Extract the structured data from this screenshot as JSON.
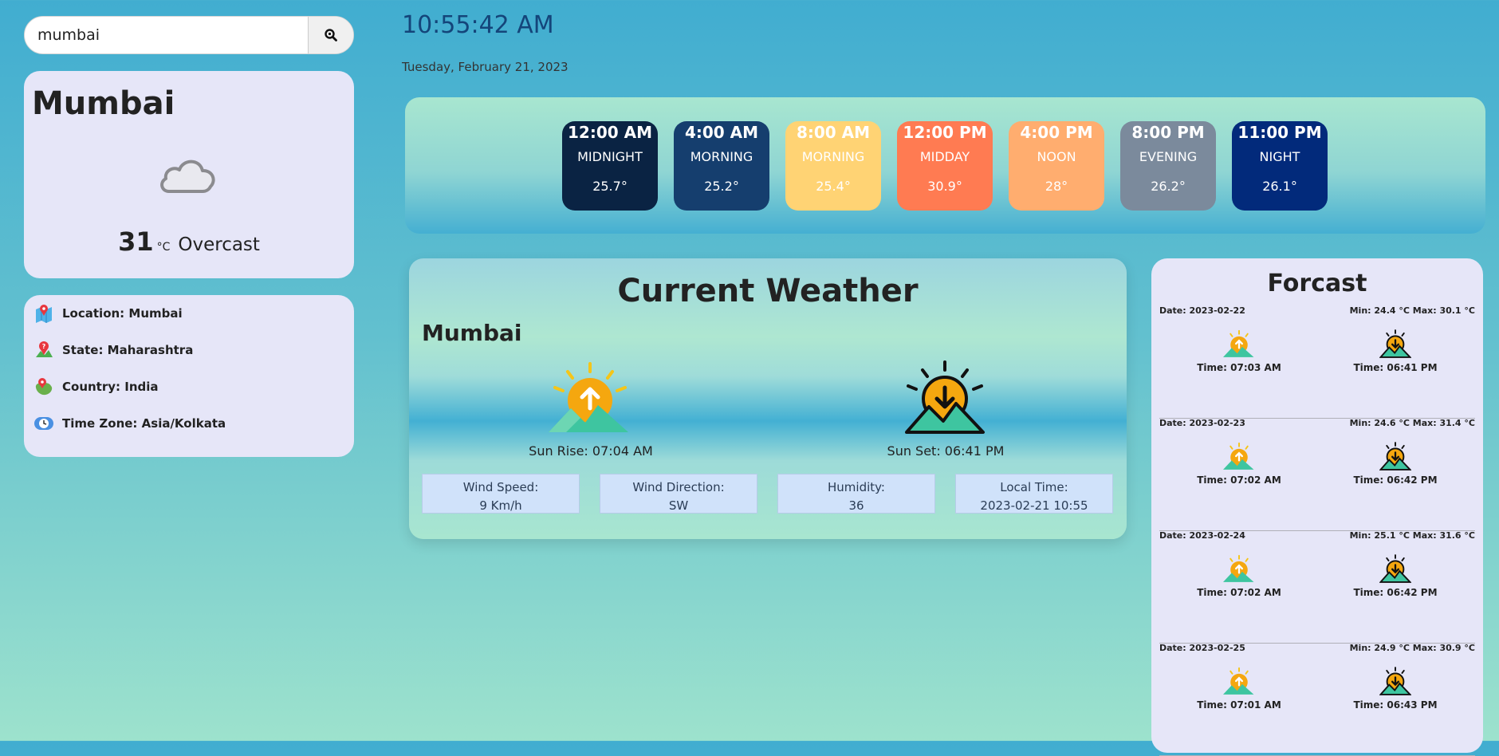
{
  "search": {
    "value": "mumbai",
    "placeholder": ""
  },
  "city_card": {
    "name": "Mumbai",
    "temp": "31",
    "unit": "°C",
    "condition": "Overcast",
    "icon": "cloud-icon"
  },
  "info": {
    "location": "Location: Mumbai",
    "state": "State: Maharashtra",
    "country": "Country: India",
    "timezone": "Time Zone: Asia/Kolkata"
  },
  "clock": {
    "time": "10:55:42 AM",
    "date": "Tuesday, February 21, 2023"
  },
  "hourly": [
    {
      "time": "12:00 AM",
      "period": "MIDNIGHT",
      "temp": "25.7°",
      "color": "#0a2343"
    },
    {
      "time": "4:00 AM",
      "period": "MORNING",
      "temp": "25.2°",
      "color": "#153e6e"
    },
    {
      "time": "8:00 AM",
      "period": "MORNING",
      "temp": "25.4°",
      "color": "#ffd374"
    },
    {
      "time": "12:00 PM",
      "period": "MIDDAY",
      "temp": "30.9°",
      "color": "#ff7b52"
    },
    {
      "time": "4:00 PM",
      "period": "NOON",
      "temp": "28°",
      "color": "#ffad6f"
    },
    {
      "time": "8:00 PM",
      "period": "EVENING",
      "temp": "26.2°",
      "color": "#7b8a9c"
    },
    {
      "time": "11:00 PM",
      "period": "NIGHT",
      "temp": "26.1°",
      "color": "#022a7b"
    }
  ],
  "current": {
    "title": "Current Weather",
    "city": "Mumbai",
    "sunrise": "Sun Rise: 07:04 AM",
    "sunset": "Sun Set: 06:41 PM",
    "stats": [
      {
        "label": "Wind Speed:",
        "value": "9 Km/h"
      },
      {
        "label": "Wind Direction:",
        "value": "SW"
      },
      {
        "label": "Humidity:",
        "value": "36"
      },
      {
        "label": "Local Time:",
        "value": "2023-02-21 10:55"
      }
    ]
  },
  "forecast": {
    "title": "Forcast",
    "days": [
      {
        "date": "Date: 2023-02-22",
        "minmax": "Min: 24.4 °C Max: 30.1 °C",
        "sunrise": "Time: 07:03 AM",
        "sunset": "Time: 06:41 PM"
      },
      {
        "date": "Date: 2023-02-23",
        "minmax": "Min: 24.6 °C Max: 31.4 °C",
        "sunrise": "Time: 07:02 AM",
        "sunset": "Time: 06:42 PM"
      },
      {
        "date": "Date: 2023-02-24",
        "minmax": "Min: 25.1 °C Max: 31.6 °C",
        "sunrise": "Time: 07:02 AM",
        "sunset": "Time: 06:42 PM"
      },
      {
        "date": "Date: 2023-02-25",
        "minmax": "Min: 24.9 °C Max: 30.9 °C",
        "sunrise": "Time: 07:01 AM",
        "sunset": "Time: 06:43 PM"
      }
    ]
  }
}
